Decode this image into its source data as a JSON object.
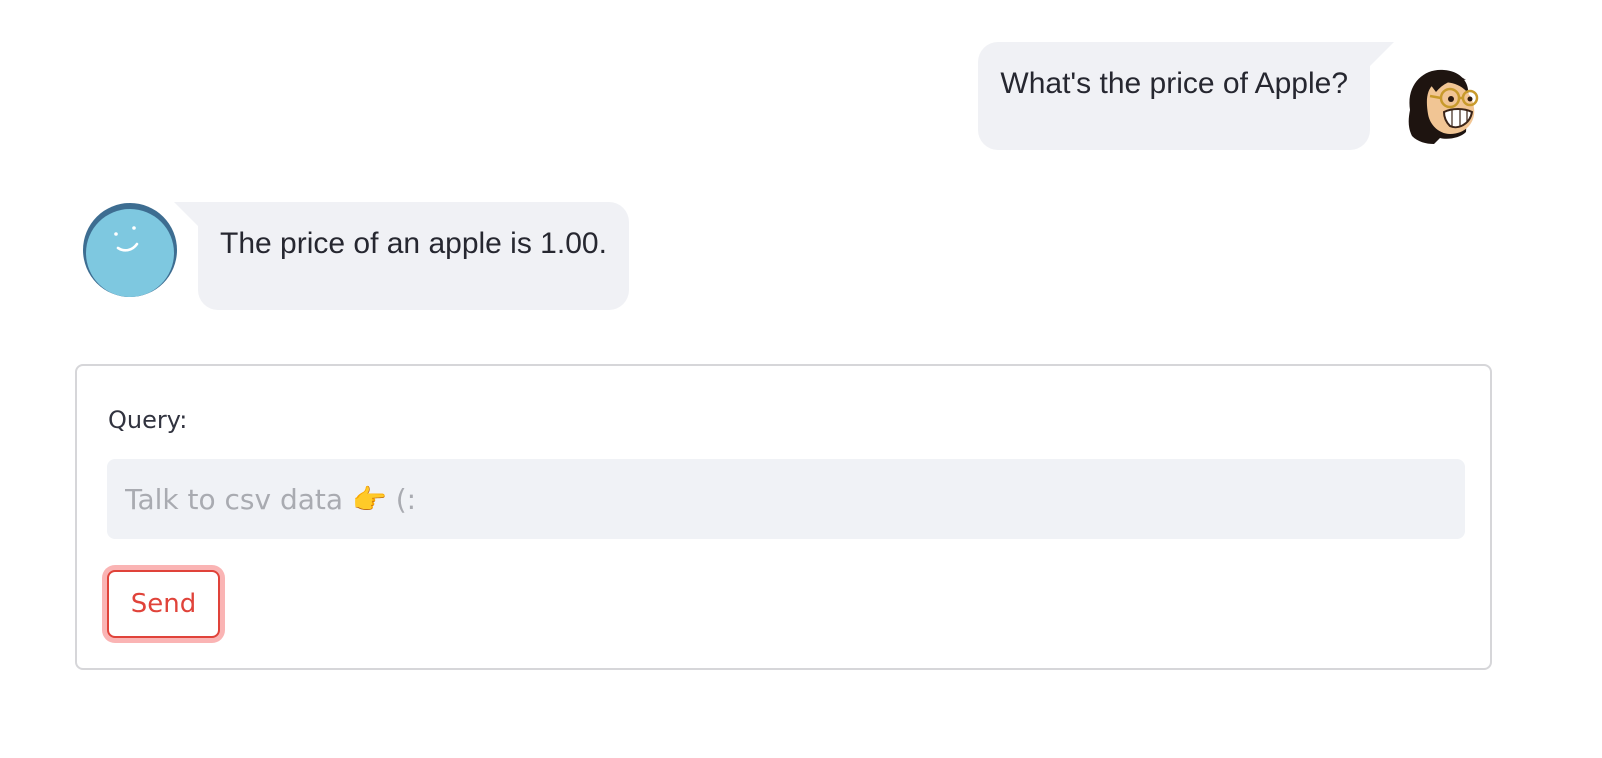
{
  "chat": {
    "messages": [
      {
        "role": "user",
        "text": "What's the price of Apple?",
        "avatar": "glasses-woman-avatar"
      },
      {
        "role": "assistant",
        "text": "The price of an apple is 1.00.",
        "avatar": "smiley-face-avatar"
      }
    ]
  },
  "form": {
    "query_label": "Query:",
    "query_placeholder": "Talk to csv data 👉 (:",
    "query_value": "",
    "send_label": "Send"
  },
  "colors": {
    "bubble_bg": "#f0f1f5",
    "input_bg": "#f0f2f6",
    "accent": "#e0433a",
    "text": "#262730",
    "bot_avatar": "#7ec8e0",
    "bot_avatar_rim": "#3d6d91"
  }
}
